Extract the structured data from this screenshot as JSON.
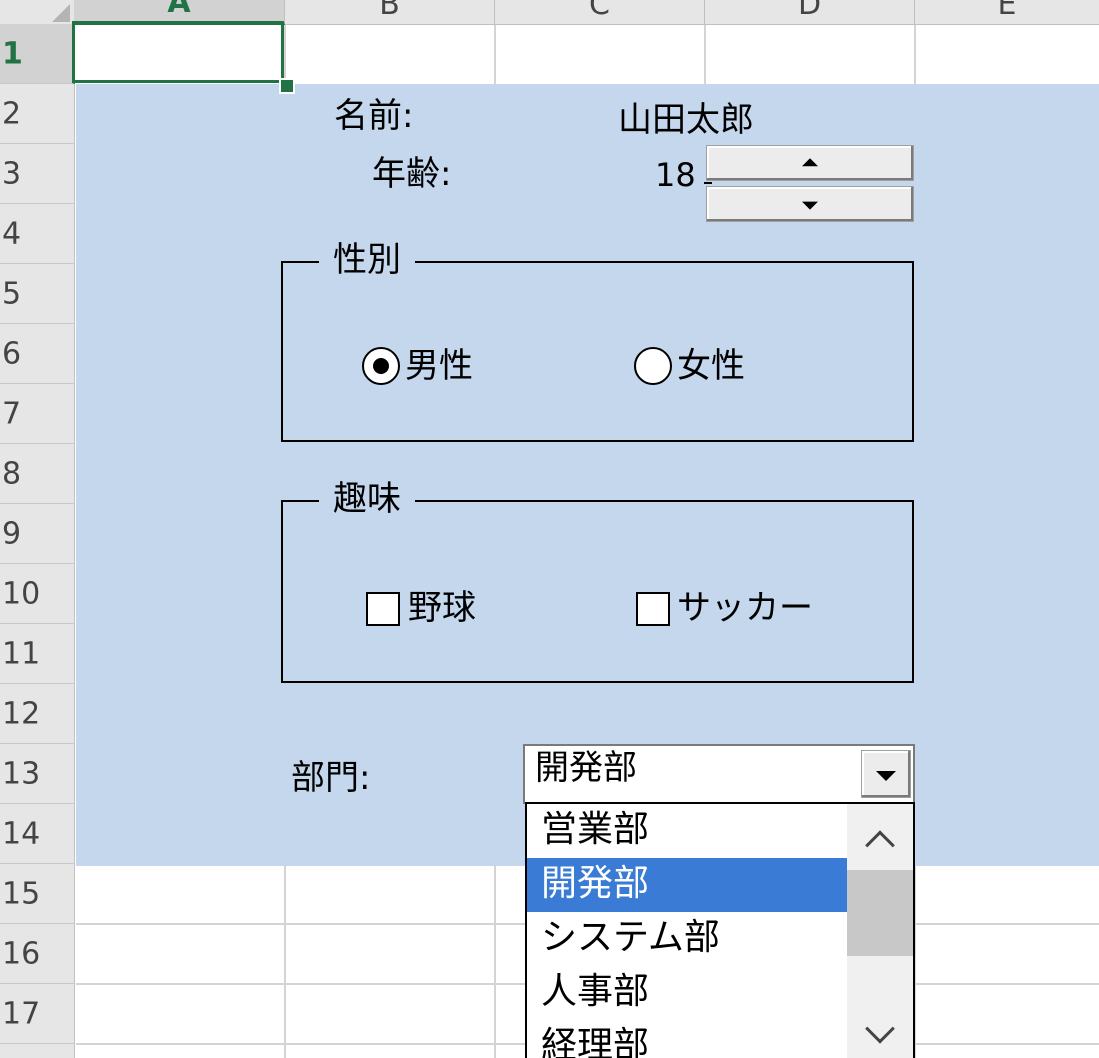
{
  "columns": [
    "A",
    "B",
    "C",
    "D",
    "E"
  ],
  "rows": [
    "1",
    "2",
    "3",
    "4",
    "5",
    "6",
    "7",
    "8",
    "9",
    "10",
    "11",
    "12",
    "13",
    "14",
    "15",
    "16",
    "17"
  ],
  "form": {
    "name_label": "名前:",
    "name_value": "山田太郎",
    "age_label": "年齢:",
    "age_value": "18",
    "gender": {
      "title": "性別",
      "options": [
        "男性",
        "女性"
      ],
      "selected": "男性"
    },
    "hobby": {
      "title": "趣味",
      "options": [
        "野球",
        "サッカー"
      ],
      "checked": []
    },
    "department": {
      "label": "部門:",
      "value": "開発部",
      "options": [
        "営業部",
        "開発部",
        "システム部",
        "人事部",
        "経理部"
      ],
      "highlighted": "開発部"
    }
  },
  "colors": {
    "form_background": "#c5d7ed",
    "selection_green": "#217346",
    "list_highlight": "#3a7bd5"
  }
}
